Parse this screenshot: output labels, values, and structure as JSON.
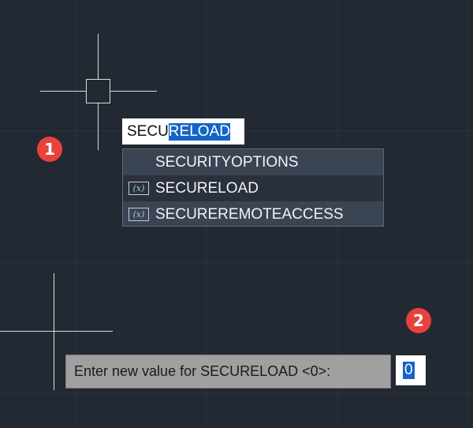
{
  "canvas": {
    "background": "#222933",
    "grid_color": "#2b323d"
  },
  "badges": [
    "1",
    "2"
  ],
  "badge_color": "#e8423a",
  "command_line": {
    "typed": "SECU",
    "autocomplete_selection": "RELOAD",
    "selection_color": "#1465c6"
  },
  "autocomplete": {
    "items": [
      {
        "label": "SECURITYOPTIONS",
        "icon": ""
      },
      {
        "label": "SECURELOAD",
        "icon": "(x)"
      },
      {
        "label": "SECUREREMOTEACCESS",
        "icon": "(x)"
      }
    ]
  },
  "prompt": {
    "label": "Enter new value for SECURELOAD <0>:",
    "value": "0"
  }
}
